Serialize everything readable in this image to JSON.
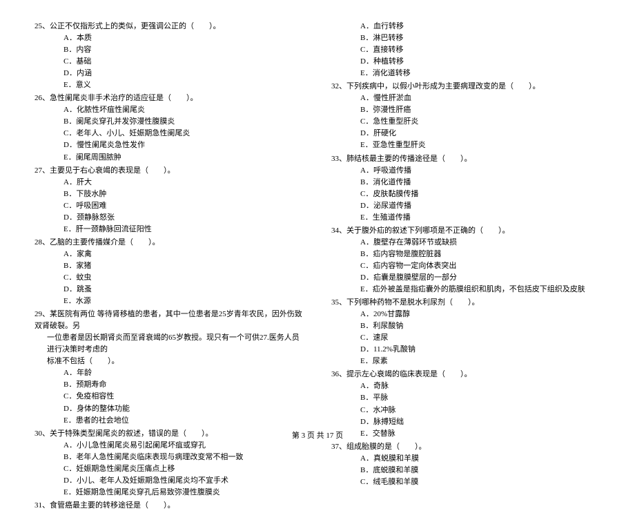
{
  "left": {
    "q25": {
      "stem": "25、公正不仅指形式上的类似，更强调公正的（　　）。",
      "opts": [
        "A．本质",
        "B．内容",
        "C．基础",
        "D．内涵",
        "E．意义"
      ]
    },
    "q26": {
      "stem": "26、急性阑尾炎非手术治疗的适应征是（　　）。",
      "opts": [
        "A．化脓性坏疽性阑尾炎",
        "B．阑尾炎穿孔并发弥漫性腹膜炎",
        "C．老年人、小儿、妊娠期急性阑尾炎",
        "D．慢性阑尾炎急性发作",
        "E．阑尾周围脓肿"
      ]
    },
    "q27": {
      "stem": "27、主要见于右心衰竭的表现是（　　）。",
      "opts": [
        "A．肝大",
        "B．下肢水肿",
        "C．呼吸困难",
        "D．颈静脉怒张",
        "E．肝一颈静脉回流征阳性"
      ]
    },
    "q28": {
      "stem": "28、乙脑的主要传播媒介是（　　）。",
      "opts": [
        "A．家禽",
        "B．家猪",
        "C．蚊虫",
        "D．跳蚤",
        "E．水源"
      ]
    },
    "q29": {
      "stem1": "29、某医院有两位 等待肾移植的患者，其中一位患者是25岁青年农民，因外伤致双肾破裂。另",
      "stem2": "一位患者是因长期肾炎而至肾衰竭的65岁教授。现只有一个可供27.医务人员进行决策时考虑的",
      "stem3": "标准不包括（　　）。",
      "opts": [
        "A．年龄",
        "B．预期寿命",
        "C．免疫相容性",
        "D．身体的整体功能",
        "E．患者的社会地位"
      ]
    },
    "q30": {
      "stem": "30、关于特殊类型阑尾炎的叙述，错误的是（　　）。",
      "opts": [
        "A．小儿急性阑尾炎易引起阑尾坏疽或穿孔",
        "B．老年人急性阑尾炎临床表现与病理改变常不相一致",
        "C．妊娠期急性阑尾炎压痛点上移",
        "D．小儿、老年人及妊娠期急性阑尾炎均不宜手术",
        "E．妊娠期急性阑尾炎穿孔后易致弥漫性腹膜炎"
      ]
    },
    "q31": {
      "stem": "31、食管癌最主要的转移途径是（　　）。"
    }
  },
  "right": {
    "q31opts": [
      "A．血行转移",
      "B．淋巴转移",
      "C．直接转移",
      "D．种植转移",
      "E．消化道转移"
    ],
    "q32": {
      "stem": "32、下列疾病中，以假小叶形成为主要病理改变的是（　　）。",
      "opts": [
        "A．慢性肝淤血",
        "B．弥漫性肝癌",
        "C．急性重型肝炎",
        "D．肝硬化",
        "E．亚急性重型肝炎"
      ]
    },
    "q33": {
      "stem": "33、肺结核最主要的传播途径是（　　）。",
      "opts": [
        "A．呼吸道传播",
        "B．消化道传播",
        "C．皮肤黏膜传播",
        "D．泌尿道传播",
        "E．生殖道传播"
      ]
    },
    "q34": {
      "stem": "34、关于腹外疝的叙述下列哪项是不正确的（　　）。",
      "opts": [
        "A．腹壁存在薄弱环节或缺损",
        "B．疝内容物是腹腔脏器",
        "C．疝内容物一定向体表突出",
        "D．疝囊是腹膜壁层的一部分",
        "E．疝外被盖是指疝囊外的筋膜组织和肌肉，不包括皮下组织及皮肤"
      ]
    },
    "q35": {
      "stem": "35、下列哪种药物不是脱水利尿剂（　　）。",
      "opts": [
        "A．20%甘露醇",
        "B．利尿酸钠",
        "C．速尿",
        "D．11.2%乳酸钠",
        "E．尿素"
      ]
    },
    "q36": {
      "stem": "36、提示左心衰竭的临床表现是（　　）。",
      "opts": [
        "A．奇脉",
        "B．平脉",
        "C．水冲脉",
        "D．脉搏短绌",
        "E．交替脉"
      ]
    },
    "q37": {
      "stem": "37、组成胎膜的是（　　）。",
      "opts": [
        "A．真蜕膜和羊膜",
        "B．底蜕膜和羊膜",
        "C．绒毛膜和羊膜"
      ]
    }
  },
  "footer": "第 3 页 共 17 页"
}
